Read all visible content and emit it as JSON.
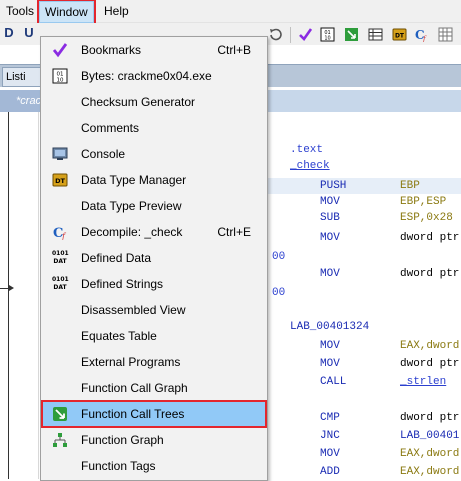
{
  "menubar": {
    "items": [
      {
        "label": "Tools"
      },
      {
        "label": "Window"
      },
      {
        "label": "Help"
      }
    ]
  },
  "toolbar": {
    "left_icons": [
      "D",
      "U"
    ],
    "right_icons": [
      "refresh-icon",
      "bookmark-check-icon",
      "bytes-icon",
      "function-call-tree-icon",
      "table-icon",
      "data-type-icon",
      "decompile-icon",
      "grid-icon"
    ]
  },
  "tabs": {
    "listing_label": "Listi",
    "subtab_label": "*crac"
  },
  "code": [
    {
      "kind": "section",
      "text": ".text"
    },
    {
      "kind": "func",
      "text": "_check"
    },
    {
      "kind": "instr",
      "mnem": "PUSH",
      "op": "EBP"
    },
    {
      "kind": "instr",
      "mnem": "MOV",
      "op": "EBP,ESP"
    },
    {
      "kind": "instr",
      "mnem": "SUB",
      "op": "ESP,0x28"
    },
    {
      "kind": "instr",
      "mnem": "MOV",
      "op": "dword ptr"
    },
    {
      "kind": "num",
      "text": "00"
    },
    {
      "kind": "instr",
      "mnem": "MOV",
      "op": "dword ptr"
    },
    {
      "kind": "num",
      "text": "00"
    },
    {
      "kind": "label",
      "text": "LAB_00401324"
    },
    {
      "kind": "instr",
      "mnem": "MOV",
      "op": "EAX,dword"
    },
    {
      "kind": "instr",
      "mnem": "MOV",
      "op": "dword ptr"
    },
    {
      "kind": "instr",
      "mnem": "CALL",
      "op": "_strlen"
    },
    {
      "kind": "instr",
      "mnem": "CMP",
      "op": "dword ptr"
    },
    {
      "kind": "instr",
      "mnem": "JNC",
      "op": "LAB_00401"
    },
    {
      "kind": "instr",
      "mnem": "MOV",
      "op": "EAX,dword"
    },
    {
      "kind": "instr",
      "mnem": "ADD",
      "op": "EAX,dword"
    }
  ],
  "window_menu": {
    "items": [
      {
        "label": "Bookmarks",
        "shortcut": "Ctrl+B",
        "icon": "bookmark-check-icon"
      },
      {
        "label": "Bytes: crackme0x04.exe",
        "shortcut": "",
        "icon": "bytes-icon"
      },
      {
        "label": "Checksum Generator",
        "shortcut": "",
        "icon": ""
      },
      {
        "label": "Comments",
        "shortcut": "",
        "icon": ""
      },
      {
        "label": "Console",
        "shortcut": "",
        "icon": "console-icon"
      },
      {
        "label": "Data Type Manager",
        "shortcut": "",
        "icon": "data-type-manager-icon"
      },
      {
        "label": "Data Type Preview",
        "shortcut": "",
        "icon": ""
      },
      {
        "label": "Decompile: _check",
        "shortcut": "Ctrl+E",
        "icon": "decompile-icon"
      },
      {
        "label": "Defined Data",
        "shortcut": "",
        "icon": "defined-data-icon"
      },
      {
        "label": "Defined Strings",
        "shortcut": "",
        "icon": "defined-strings-icon"
      },
      {
        "label": "Disassembled View",
        "shortcut": "",
        "icon": ""
      },
      {
        "label": "Equates Table",
        "shortcut": "",
        "icon": ""
      },
      {
        "label": "External Programs",
        "shortcut": "",
        "icon": ""
      },
      {
        "label": "Function Call Graph",
        "shortcut": "",
        "icon": ""
      },
      {
        "label": "Function Call Trees",
        "shortcut": "",
        "icon": "function-call-tree-icon",
        "active": true
      },
      {
        "label": "Function Graph",
        "shortcut": "",
        "icon": "function-graph-icon"
      },
      {
        "label": "Function Tags",
        "shortcut": "",
        "icon": ""
      }
    ],
    "icon_text": {
      "data_type": "DT",
      "defined_data": "0101 DAT",
      "defined_strings": "0101 DAT"
    }
  },
  "colors": {
    "highlight": "#91c9f7",
    "annotation": "#e3262e"
  }
}
